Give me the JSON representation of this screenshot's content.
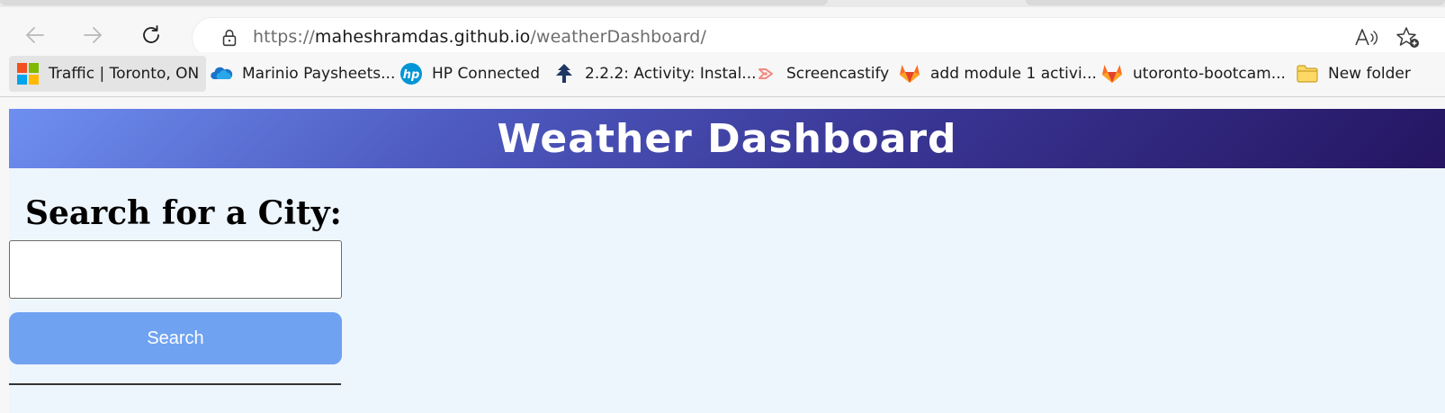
{
  "browser": {
    "url": {
      "scheme": "https://",
      "host": "maheshramdas.github.io",
      "path": "/weatherDashboard/"
    },
    "nav_icons": [
      "back-arrow-icon",
      "forward-arrow-icon",
      "refresh-icon"
    ],
    "address_icons": [
      "lock-icon",
      "read-aloud-icon",
      "favorite-star-icon"
    ]
  },
  "bookmarks": [
    {
      "label": "Traffic | Toronto, ON",
      "icon": "microsoft-logo-icon"
    },
    {
      "label": "Marinio Paysheets...",
      "icon": "onedrive-cloud-icon"
    },
    {
      "label": "HP Connected",
      "icon": "hp-logo-icon"
    },
    {
      "label": "2.2.2: Activity: Instal...",
      "icon": "uoft-tree-icon"
    },
    {
      "label": "Screencastify",
      "icon": "screencastify-icon"
    },
    {
      "label": "add module 1 activi...",
      "icon": "gitlab-fox-icon"
    },
    {
      "label": "utoronto-bootcam...",
      "icon": "gitlab-fox-icon"
    },
    {
      "label": "New folder",
      "icon": "folder-icon"
    }
  ],
  "page": {
    "header_title": "Weather Dashboard",
    "search_heading": "Search for a City:",
    "search_input_value": "",
    "search_button_label": "Search"
  },
  "colors": {
    "header_gradient_start": "#6e8ff0",
    "header_gradient_end": "#251561",
    "page_background": "#eef6fd",
    "search_button": "#6fa2f1"
  }
}
